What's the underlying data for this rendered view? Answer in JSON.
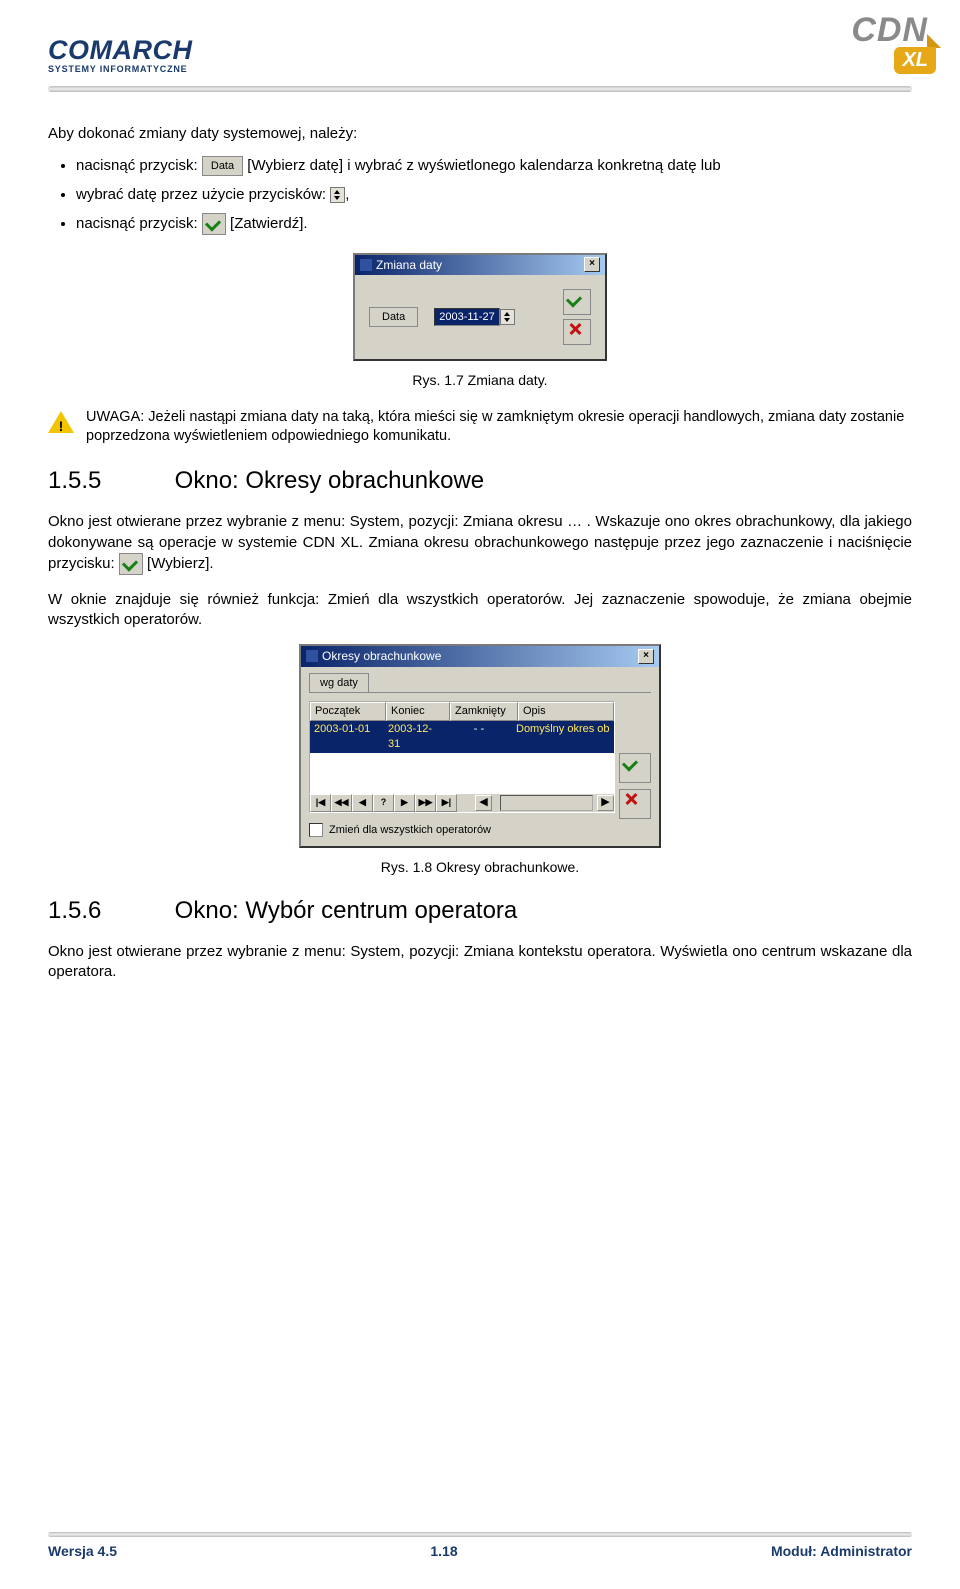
{
  "header": {
    "brand": "COMARCH",
    "brand_sub": "SYSTEMY INFORMATYCZNE",
    "product_top": "CDN",
    "product_bottom": "XL"
  },
  "intro_title": "Aby dokonać zmiany daty systemowej, należy:",
  "bullets": {
    "b1_prefix": "nacisnąć przycisk: ",
    "b1_btn": "Data",
    "b1_suffix": " [Wybierz datę] i wybrać z wyświetlonego kalendarza konkretną datę lub",
    "b2_prefix": "wybrać datę przez użycie przycisków: ",
    "b2_suffix": ",",
    "b3_prefix": "nacisnąć przycisk: ",
    "b3_suffix": " [Zatwierdź]."
  },
  "dlg1": {
    "title": "Zmiana daty",
    "data_btn": "Data",
    "date_value": "2003-11-27"
  },
  "caption1": "Rys. 1.7 Zmiana daty.",
  "warning": "UWAGA: Jeżeli nastąpi zmiana daty na taką, która mieści się w zamkniętym okresie operacji handlowych, zmiana daty zostanie poprzedzona wyświetleniem odpowiedniego komunikatu.",
  "section155": {
    "num": "1.5.5",
    "title": "Okno: Okresy obrachunkowe",
    "text_a": "Okno jest otwierane przez wybranie z menu: System, pozycji: Zmiana okresu … . Wskazuje ono okres obrachunkowy, dla jakiego dokonywane są operacje w systemie CDN XL. Zmiana okresu obrachunkowego następuje przez jego zaznaczenie i naciśnięcie przycisku: ",
    "text_b": " [Wybierz].",
    "text_c": "W oknie znajduje się również funkcja: Zmień dla wszystkich operatorów. Jej zaznaczenie spowoduje, że zmiana obejmie wszystkich operatorów."
  },
  "dlg2": {
    "title": "Okresy obrachunkowe",
    "tab": "wg daty",
    "cols": {
      "c1": "Początek",
      "c2": "Koniec",
      "c3": "Zamknięty",
      "c4": "Opis"
    },
    "row": {
      "c1": "2003-01-01",
      "c2": "2003-12-31",
      "c3": "-  -",
      "c4": "Domyślny okres ob"
    },
    "nav": [
      "|◀",
      "◀◀",
      "◀",
      "?",
      "▶",
      "▶▶",
      "▶|"
    ],
    "scroll_l": "◀",
    "scroll_r": "▶",
    "checkbox_label": "Zmień dla wszystkich operatorów"
  },
  "caption2": "Rys. 1.8 Okresy obrachunkowe.",
  "section156": {
    "num": "1.5.6",
    "title": "Okno: Wybór centrum operatora",
    "text": "Okno jest otwierane przez wybranie z menu: System, pozycji: Zmiana kontekstu operatora. Wyświetla ono centrum wskazane dla operatora."
  },
  "footer": {
    "left": "Wersja 4.5",
    "center": "1.18",
    "right": "Moduł: Administrator"
  }
}
